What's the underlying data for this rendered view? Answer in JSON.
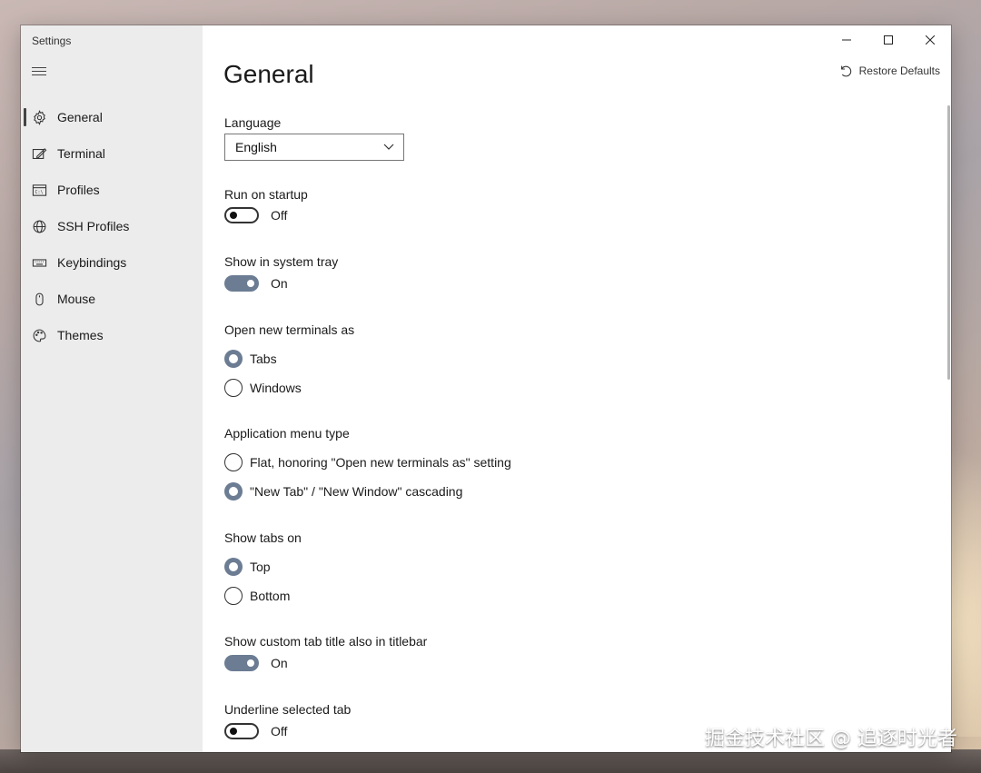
{
  "app": {
    "title": "Settings"
  },
  "sidebar": {
    "items": [
      {
        "label": "General",
        "icon": "gear-icon",
        "active": true
      },
      {
        "label": "Terminal",
        "icon": "terminal-pen-icon"
      },
      {
        "label": "Profiles",
        "icon": "profiles-icon"
      },
      {
        "label": "SSH Profiles",
        "icon": "globe-icon"
      },
      {
        "label": "Keybindings",
        "icon": "keyboard-icon"
      },
      {
        "label": "Mouse",
        "icon": "mouse-icon"
      },
      {
        "label": "Themes",
        "icon": "palette-icon"
      }
    ]
  },
  "header": {
    "title": "General",
    "restore_label": "Restore Defaults"
  },
  "settings": {
    "language": {
      "label": "Language",
      "value": "English"
    },
    "run_on_startup": {
      "label": "Run on startup",
      "state": "Off"
    },
    "system_tray": {
      "label": "Show in system tray",
      "state": "On"
    },
    "open_new_as": {
      "label": "Open new terminals as",
      "options": [
        "Tabs",
        "Windows"
      ],
      "selected": "Tabs"
    },
    "app_menu_type": {
      "label": "Application menu type",
      "options": [
        "Flat, honoring \"Open new terminals as\" setting",
        "\"New Tab\" / \"New Window\" cascading"
      ],
      "selected": "\"New Tab\" / \"New Window\" cascading"
    },
    "show_tabs_on": {
      "label": "Show tabs on",
      "options": [
        "Top",
        "Bottom"
      ],
      "selected": "Top"
    },
    "custom_tab_title": {
      "label": "Show custom tab title also in titlebar",
      "state": "On"
    },
    "underline_tab": {
      "label": "Underline selected tab",
      "state": "Off"
    }
  },
  "colors": {
    "accent": "#6b7c93",
    "sidebar_bg": "#ececec"
  },
  "watermark": "掘金技术社区 @ 追逐时光者"
}
